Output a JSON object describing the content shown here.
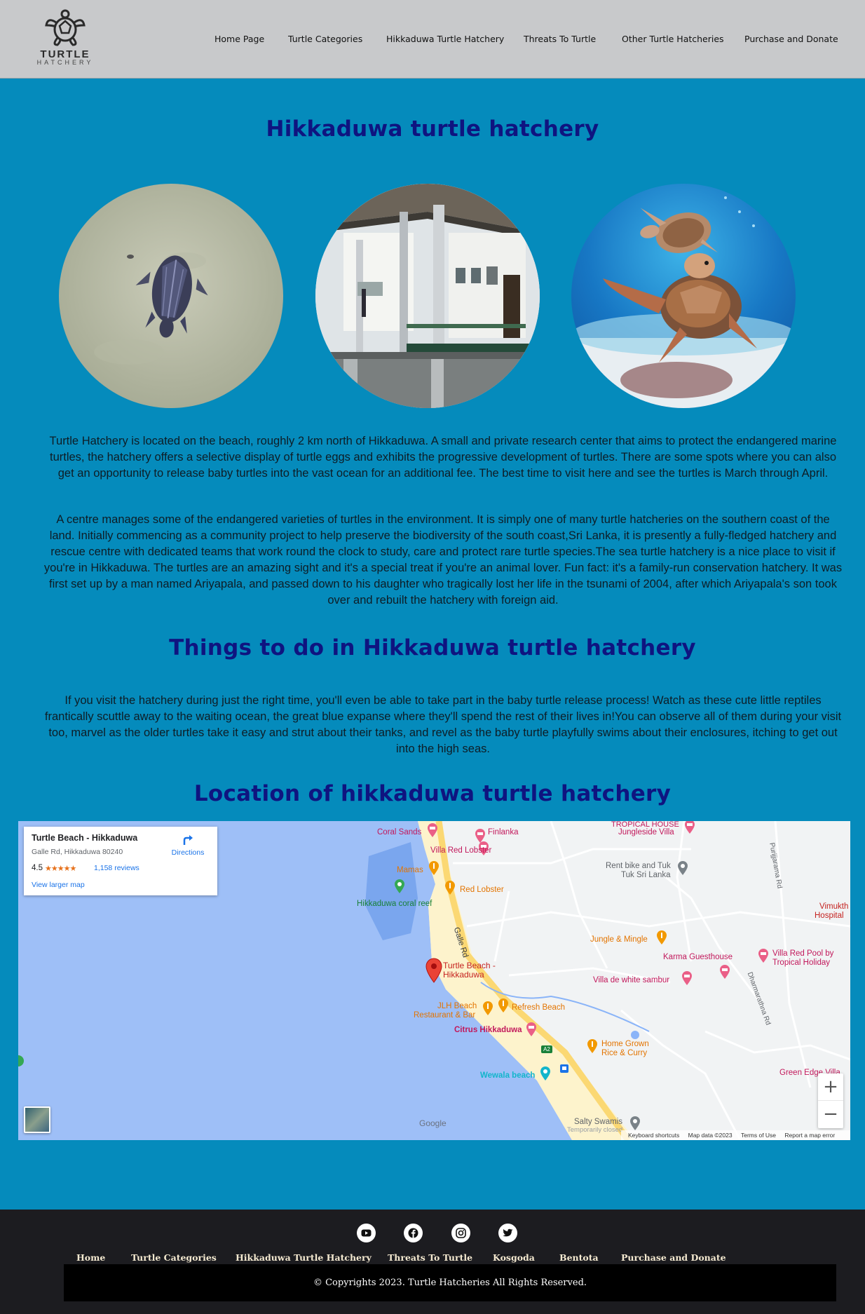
{
  "logo": {
    "line1": "TURTLE",
    "line2": "HATCHERY"
  },
  "nav": [
    "Home Page",
    "Turtle Categories",
    "Hikkaduwa Turtle Hatchery",
    "Threats To Turtle",
    "Other Turtle Hatcheries",
    "Purchase and Donate"
  ],
  "headings": {
    "main": "Hikkaduwa turtle hatchery",
    "things": "Things to do in Hikkaduwa turtle hatchery",
    "location": "Location of hikkaduwa turtle hatchery"
  },
  "paragraphs": {
    "p1": "Turtle Hatchery is located on the beach, roughly 2 km north of Hikkaduwa. A small and private research center that aims to protect the endangered marine turtles, the hatchery offers a selective display of turtle eggs and exhibits the progressive development of turtles. There are some spots where you can also get an opportunity to release baby turtles into the vast ocean for an additional fee. The best time to visit here and see the turtles is March through April.",
    "p2": "A centre manages some of the endangered varieties of turtles in the environment. It is simply one of many turtle hatcheries on the southern coast of the land. Initially commencing as a community project to help preserve the biodiversity of the south coast,Sri Lanka, it is presently a fully-fledged hatchery and rescue centre with dedicated teams that work round the clock to study, care and protect rare turtle species.The sea turtle hatchery is a nice place to visit if you're in Hikkaduwa. The turtles are an amazing sight and it's a special treat if you're an animal lover. Fun fact: it's a family-run conservation hatchery. It was first set up by a man named Ariyapala, and passed down to his daughter who tragically lost her life in the tsunami of 2004, after which Ariyapala's son took over and rebuilt the hatchery with foreign aid.",
    "p3": "If you visit the hatchery during just the right time, you'll even be able to take part in the baby turtle release process! Watch as these cute little reptiles frantically scuttle away to the waiting ocean, the great blue expanse where they'll spend the rest of their lives in!You can observe all of them during your visit too, marvel as the older turtles take it easy and strut about their tanks, and revel as the baby turtle playfully swims about their enclosures, itching to get out into the high seas."
  },
  "map": {
    "place": "Turtle Beach - Hikkaduwa",
    "address": "Galle Rd, Hikkaduwa 80240",
    "rating": "4.5",
    "stars": "★★★★★",
    "reviews": "1,158 reviews",
    "view_larger": "View larger map",
    "directions": "Directions",
    "pin_label_1": "Turtle Beach -",
    "pin_label_2": "Hikkaduwa",
    "labels": {
      "coral_sands": "Coral Sands",
      "finlanka": "Finlanka",
      "villa_red_lobster": "Villa Red Lobster",
      "mamas": "Mamas",
      "red_lobster": "Red Lobster",
      "coral_reef": "Hikkaduwa coral reef",
      "tropical_house": "TROPICAL HOUSE",
      "jungleside": "Jungleside Villa",
      "rent_bike_1": "Rent bike and Tuk",
      "rent_bike_2": "Tuk Sri Lanka",
      "purijjarama": "Purijjarama Rd",
      "vimukthi_1": "Vimukth",
      "vimukthi_2": "Hospital",
      "galle_rd": "Galle Rd",
      "jungle_mingle": "Jungle & Mingle",
      "karma": "Karma Guesthouse",
      "villa_red_pool_1": "Villa Red Pool by",
      "villa_red_pool_2": "Tropical Holiday",
      "villa_white": "Villa de white sambur",
      "dharmarathna": "Dharmarathna Rd",
      "jlh_1": "JLH Beach",
      "jlh_2": "Restaurant & Bar",
      "refresh": "Refresh Beach",
      "citrus": "Citrus Hikkaduwa",
      "a2": "A2",
      "home_grown_1": "Home Grown",
      "home_grown_2": "Rice & Curry",
      "wewala": "Wewala beach",
      "green_edge": "Green Edge Villa",
      "salty_1": "Salty Swamis",
      "salty_2": "Temporarily closed"
    },
    "google": "Google",
    "attribution": [
      "Keyboard shortcuts",
      "Map data ©2023",
      "Terms of Use",
      "Report a map error"
    ],
    "zoom_in": "+",
    "zoom_out": "−"
  },
  "footer": {
    "nav": [
      "Home",
      "Turtle Categories",
      "Hikkaduwa Turtle Hatchery",
      "Threats To Turtle",
      "Kosgoda",
      "Bentota",
      "Purchase and Donate"
    ],
    "copyright": "© Copyrights 2023. Turtle Hatcheries All Rights Reserved."
  }
}
